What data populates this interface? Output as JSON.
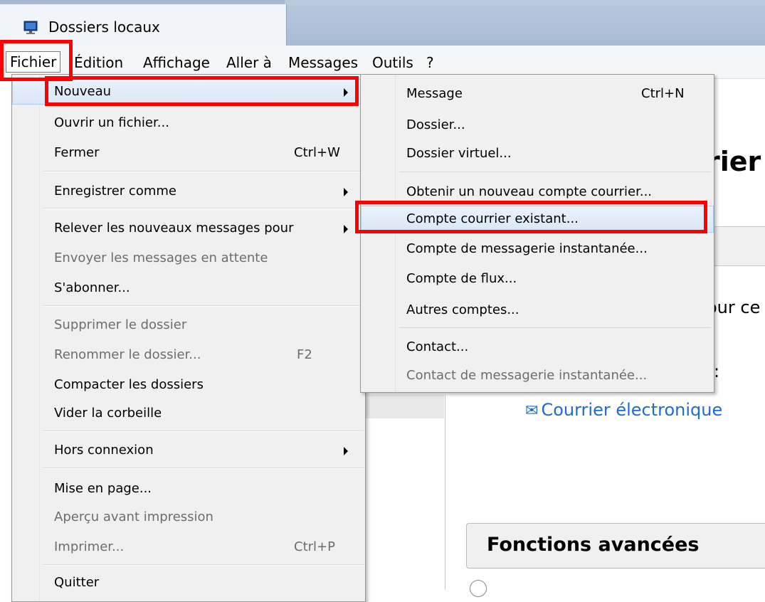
{
  "window": {
    "tab_title": "Dossiers locaux",
    "tab_icon": "monitor-icon"
  },
  "menubar": {
    "items": [
      "Fichier",
      "Édition",
      "Affichage",
      "Aller à",
      "Messages",
      "Outils",
      "?"
    ]
  },
  "file_menu": {
    "items": [
      {
        "label": "Nouveau",
        "submenu": true,
        "state": "highlighted"
      },
      {
        "label": "Ouvrir un fichier..."
      },
      {
        "label": "Fermer",
        "shortcut": "Ctrl+W"
      },
      {
        "label": "Enregistrer comme",
        "submenu": true
      },
      {
        "label": "Relever les nouveaux messages pour",
        "submenu": true
      },
      {
        "label": "Envoyer les messages en attente",
        "state": "disabled"
      },
      {
        "label": "S'abonner..."
      },
      {
        "label": "Supprimer le dossier",
        "state": "disabled"
      },
      {
        "label": "Renommer le dossier...",
        "shortcut": "F2",
        "state": "disabled"
      },
      {
        "label": "Compacter les dossiers"
      },
      {
        "label": "Vider la corbeille"
      },
      {
        "label": "Hors connexion",
        "submenu": true
      },
      {
        "label": "Mise en page..."
      },
      {
        "label": "Aperçu avant impression",
        "state": "disabled"
      },
      {
        "label": "Imprimer...",
        "shortcut": "Ctrl+P",
        "state": "disabled"
      },
      {
        "label": "Quitter"
      }
    ]
  },
  "new_submenu": {
    "items": [
      {
        "label": "Message",
        "shortcut": "Ctrl+N"
      },
      {
        "label": "Dossier..."
      },
      {
        "label": "Dossier virtuel..."
      },
      {
        "label": "Obtenir un nouveau compte courrier..."
      },
      {
        "label": "Compte courrier existant...",
        "state": "highlighted"
      },
      {
        "label": "Compte de messagerie instantanée..."
      },
      {
        "label": "Compte de flux..."
      },
      {
        "label": "Autres comptes..."
      },
      {
        "label": "Contact..."
      },
      {
        "label": "Contact de messagerie instantanée...",
        "state": "disabled"
      }
    ]
  },
  "background": {
    "heading_fragment": "rier -",
    "text_fragment_1": "our ce",
    "text_fragment_2": ":",
    "email_link": "Courrier électronique",
    "email_icon": "envelope-icon",
    "advanced_title": "Fonctions avancées"
  },
  "colors": {
    "annotation": "#ff0000",
    "link": "#1f6bd1",
    "menu_bg": "#f0f0f0"
  }
}
